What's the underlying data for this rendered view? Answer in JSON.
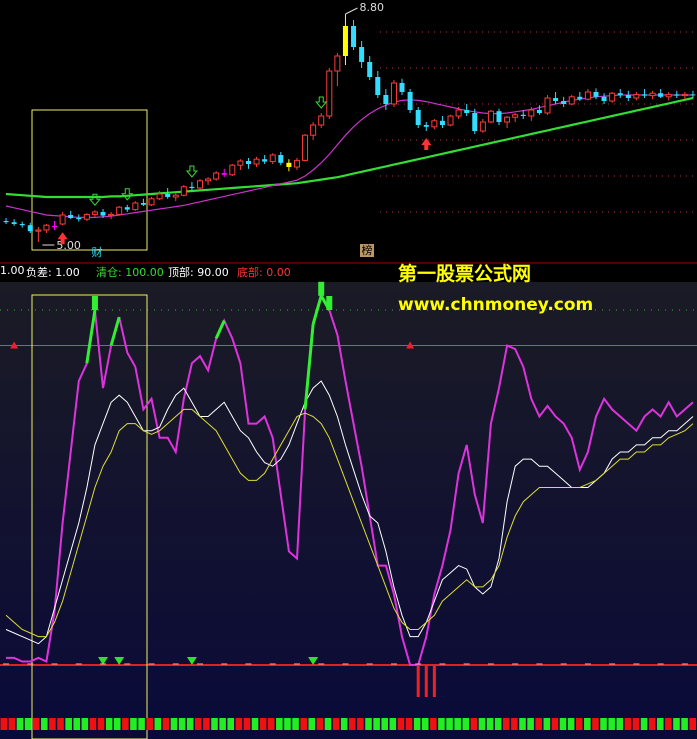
{
  "watermark": {
    "title": "第一股票公式网",
    "url": "www.chnmoney.com"
  },
  "indicator_bar": {
    "items": [
      {
        "text": "1.00",
        "color": "#ffffff"
      },
      {
        "text": "负差: 1.00",
        "color": "#ffffff"
      },
      {
        "text": "清仓: 100.00",
        "color": "#33dd33"
      },
      {
        "text": "顶部: 90.00",
        "color": "#ffffff"
      },
      {
        "text": "底部: 0.00",
        "color": "#ff3333"
      }
    ]
  },
  "colors": {
    "up": "#ff3b3b",
    "down": "#33ddff",
    "signal_magenta": "#ff00ff",
    "signal_yellow": "#ffff00",
    "ma_long": "#33dd33",
    "ma_short": "#cc33cc",
    "osc_fast": "#dd33dd",
    "osc_mid": "#ffffff",
    "osc_slow": "#dddd33"
  },
  "chart_data": [
    {
      "type": "candlestick",
      "title": "",
      "annotations": [
        {
          "text": "8.80",
          "kind": "high"
        },
        {
          "text": "5.00",
          "kind": "low"
        },
        {
          "text": "财",
          "kind": "marker"
        },
        {
          "text": "榜",
          "kind": "marker"
        }
      ],
      "x": [
        1,
        2,
        3,
        4,
        5,
        6,
        7,
        8,
        9,
        10,
        11,
        12,
        13,
        14,
        15,
        16,
        17,
        18,
        19,
        20,
        21,
        22,
        23,
        24,
        25,
        26,
        27,
        28,
        29,
        30,
        31,
        32,
        33,
        34,
        35,
        36,
        37,
        38,
        39,
        40,
        41,
        42,
        43,
        44,
        45,
        46,
        47,
        48,
        49,
        50,
        51,
        52,
        53,
        54,
        55,
        56,
        57,
        58,
        59,
        60,
        61,
        62,
        63,
        64,
        65,
        66,
        67,
        68,
        69,
        70,
        71,
        72,
        73,
        74,
        75,
        76,
        77,
        78,
        79,
        80,
        81,
        82,
        83,
        84,
        85,
        86
      ],
      "ohlc": [
        [
          5.35,
          5.4,
          5.3,
          5.33
        ],
        [
          5.33,
          5.38,
          5.27,
          5.3
        ],
        [
          5.3,
          5.34,
          5.24,
          5.28
        ],
        [
          5.28,
          5.32,
          5.15,
          5.18
        ],
        [
          5.18,
          5.25,
          5.0,
          5.2
        ],
        [
          5.2,
          5.3,
          5.15,
          5.28
        ],
        [
          5.27,
          5.35,
          5.2,
          5.25
        ],
        [
          5.3,
          5.5,
          5.28,
          5.45
        ],
        [
          5.45,
          5.52,
          5.38,
          5.4
        ],
        [
          5.4,
          5.46,
          5.34,
          5.38
        ],
        [
          5.38,
          5.48,
          5.35,
          5.46
        ],
        [
          5.46,
          5.53,
          5.42,
          5.5
        ],
        [
          5.5,
          5.55,
          5.4,
          5.44
        ],
        [
          5.44,
          5.5,
          5.38,
          5.46
        ],
        [
          5.46,
          5.6,
          5.44,
          5.58
        ],
        [
          5.58,
          5.62,
          5.5,
          5.54
        ],
        [
          5.54,
          5.68,
          5.52,
          5.65
        ],
        [
          5.65,
          5.72,
          5.6,
          5.62
        ],
        [
          5.62,
          5.75,
          5.6,
          5.72
        ],
        [
          5.72,
          5.85,
          5.7,
          5.8
        ],
        [
          5.8,
          5.9,
          5.72,
          5.75
        ],
        [
          5.75,
          5.82,
          5.68,
          5.78
        ],
        [
          5.78,
          5.95,
          5.76,
          5.92
        ],
        [
          5.92,
          6.0,
          5.85,
          5.9
        ],
        [
          5.9,
          6.05,
          5.88,
          6.02
        ],
        [
          6.02,
          6.08,
          5.95,
          6.05
        ],
        [
          6.05,
          6.18,
          6.02,
          6.15
        ],
        [
          6.15,
          6.22,
          6.08,
          6.12
        ],
        [
          6.12,
          6.3,
          6.1,
          6.28
        ],
        [
          6.28,
          6.38,
          6.2,
          6.35
        ],
        [
          6.35,
          6.4,
          6.22,
          6.3
        ],
        [
          6.3,
          6.42,
          6.25,
          6.38
        ],
        [
          6.38,
          6.45,
          6.3,
          6.34
        ],
        [
          6.34,
          6.48,
          6.3,
          6.45
        ],
        [
          6.45,
          6.5,
          6.28,
          6.32
        ],
        [
          6.32,
          6.38,
          6.18,
          6.25
        ],
        [
          6.25,
          6.4,
          6.2,
          6.36
        ],
        [
          6.36,
          6.8,
          6.34,
          6.78
        ],
        [
          6.78,
          7.0,
          6.7,
          6.95
        ],
        [
          6.95,
          7.15,
          6.9,
          7.1
        ],
        [
          7.1,
          7.9,
          7.05,
          7.85
        ],
        [
          7.85,
          8.15,
          7.6,
          8.1
        ],
        [
          8.1,
          8.8,
          7.95,
          8.6
        ],
        [
          8.6,
          8.7,
          8.2,
          8.25
        ],
        [
          8.25,
          8.35,
          7.9,
          8.0
        ],
        [
          8.0,
          8.1,
          7.7,
          7.75
        ],
        [
          7.75,
          7.85,
          7.4,
          7.45
        ],
        [
          7.45,
          7.55,
          7.2,
          7.3
        ],
        [
          7.3,
          7.7,
          7.25,
          7.65
        ],
        [
          7.65,
          7.72,
          7.45,
          7.5
        ],
        [
          7.5,
          7.55,
          7.15,
          7.2
        ],
        [
          7.2,
          7.25,
          6.9,
          6.95
        ],
        [
          6.95,
          7.0,
          6.85,
          6.92
        ],
        [
          6.92,
          7.05,
          6.88,
          7.02
        ],
        [
          7.02,
          7.1,
          6.9,
          6.95
        ],
        [
          6.95,
          7.12,
          6.93,
          7.1
        ],
        [
          7.1,
          7.25,
          7.05,
          7.2
        ],
        [
          7.2,
          7.3,
          7.1,
          7.15
        ],
        [
          7.15,
          7.22,
          6.8,
          6.85
        ],
        [
          6.85,
          7.05,
          6.82,
          7.0
        ],
        [
          7.0,
          7.2,
          6.98,
          7.18
        ],
        [
          7.18,
          7.22,
          6.95,
          7.0
        ],
        [
          7.0,
          7.1,
          6.9,
          7.08
        ],
        [
          7.08,
          7.15,
          7.0,
          7.12
        ],
        [
          7.12,
          7.2,
          7.05,
          7.1
        ],
        [
          7.1,
          7.25,
          7.02,
          7.2
        ],
        [
          7.2,
          7.28,
          7.12,
          7.15
        ],
        [
          7.15,
          7.45,
          7.12,
          7.4
        ],
        [
          7.4,
          7.5,
          7.3,
          7.35
        ],
        [
          7.35,
          7.42,
          7.25,
          7.3
        ],
        [
          7.3,
          7.45,
          7.28,
          7.42
        ],
        [
          7.42,
          7.5,
          7.35,
          7.38
        ],
        [
          7.38,
          7.55,
          7.36,
          7.5
        ],
        [
          7.5,
          7.56,
          7.38,
          7.42
        ],
        [
          7.42,
          7.48,
          7.3,
          7.35
        ],
        [
          7.35,
          7.5,
          7.32,
          7.48
        ],
        [
          7.48,
          7.55,
          7.4,
          7.45
        ],
        [
          7.45,
          7.52,
          7.35,
          7.4
        ],
        [
          7.4,
          7.5,
          7.36,
          7.46
        ],
        [
          7.46,
          7.55,
          7.4,
          7.44
        ],
        [
          7.44,
          7.52,
          7.38,
          7.48
        ],
        [
          7.48,
          7.55,
          7.4,
          7.42
        ],
        [
          7.42,
          7.5,
          7.36,
          7.46
        ],
        [
          7.46,
          7.52,
          7.4,
          7.44
        ],
        [
          7.44,
          7.5,
          7.38,
          7.46
        ],
        [
          7.46,
          7.52,
          7.4,
          7.45
        ]
      ],
      "special_bars": [
        {
          "index": 6,
          "style": "magenta"
        },
        {
          "index": 27,
          "style": "magenta"
        },
        {
          "index": 35,
          "style": "yellow"
        },
        {
          "index": 42,
          "style": "yellow"
        }
      ],
      "ma_long": [
        5.8,
        5.79,
        5.78,
        5.77,
        5.76,
        5.75,
        5.75,
        5.75,
        5.75,
        5.75,
        5.75,
        5.75,
        5.75,
        5.76,
        5.76,
        5.77,
        5.78,
        5.79,
        5.8,
        5.81,
        5.82,
        5.83,
        5.84,
        5.85,
        5.86,
        5.87,
        5.88,
        5.89,
        5.9,
        5.91,
        5.92,
        5.93,
        5.94,
        5.95,
        5.96,
        5.97,
        5.98,
        6.0,
        6.02,
        6.04,
        6.06,
        6.08,
        6.11,
        6.14,
        6.17,
        6.2,
        6.23,
        6.26,
        6.29,
        6.32,
        6.35,
        6.38,
        6.41,
        6.44,
        6.47,
        6.5,
        6.53,
        6.56,
        6.59,
        6.62,
        6.65,
        6.68,
        6.71,
        6.74,
        6.77,
        6.8,
        6.83,
        6.86,
        6.89,
        6.92,
        6.95,
        6.98,
        7.01,
        7.04,
        7.07,
        7.1,
        7.13,
        7.16,
        7.19,
        7.22,
        7.25,
        7.28,
        7.31,
        7.34,
        7.37,
        7.4
      ],
      "ma_short": [
        5.6,
        5.57,
        5.54,
        5.51,
        5.48,
        5.45,
        5.44,
        5.43,
        5.42,
        5.41,
        5.41,
        5.41,
        5.42,
        5.43,
        5.45,
        5.47,
        5.49,
        5.51,
        5.53,
        5.55,
        5.57,
        5.59,
        5.61,
        5.64,
        5.67,
        5.7,
        5.73,
        5.76,
        5.79,
        5.82,
        5.85,
        5.88,
        5.91,
        5.94,
        5.97,
        6.0,
        6.03,
        6.1,
        6.2,
        6.32,
        6.46,
        6.62,
        6.78,
        6.92,
        7.04,
        7.14,
        7.22,
        7.28,
        7.33,
        7.36,
        7.37,
        7.36,
        7.34,
        7.31,
        7.28,
        7.25,
        7.22,
        7.19,
        7.17,
        7.15,
        7.14,
        7.14,
        7.15,
        7.17,
        7.19,
        7.21,
        7.24,
        7.27,
        7.3,
        7.33,
        7.36,
        7.38,
        7.4,
        7.42,
        7.43,
        7.44,
        7.45,
        7.45,
        7.45,
        7.45,
        7.45,
        7.45,
        7.45,
        7.45,
        7.45,
        7.45
      ]
    },
    {
      "type": "line",
      "title": "",
      "ylim": [
        -5,
        105
      ],
      "levels": {
        "top": 90,
        "bottom": 0,
        "clear": 100
      },
      "x": [
        1,
        2,
        3,
        4,
        5,
        6,
        7,
        8,
        9,
        10,
        11,
        12,
        13,
        14,
        15,
        16,
        17,
        18,
        19,
        20,
        21,
        22,
        23,
        24,
        25,
        26,
        27,
        28,
        29,
        30,
        31,
        32,
        33,
        34,
        35,
        36,
        37,
        38,
        39,
        40,
        41,
        42,
        43,
        44,
        45,
        46,
        47,
        48,
        49,
        50,
        51,
        52,
        53,
        54,
        55,
        56,
        57,
        58,
        59,
        60,
        61,
        62,
        63,
        64,
        65,
        66,
        67,
        68,
        69,
        70,
        71,
        72,
        73,
        74,
        75,
        76,
        77,
        78,
        79,
        80,
        81,
        82,
        83,
        84,
        85,
        86
      ],
      "series": [
        {
          "values": [
            2,
            2,
            1,
            1,
            2,
            1,
            15,
            40,
            60,
            80,
            85,
            100,
            78,
            90,
            98,
            88,
            84,
            72,
            75,
            64,
            64,
            60,
            75,
            85,
            87,
            83,
            92,
            97,
            92,
            85,
            68,
            68,
            70,
            64,
            48,
            32,
            30,
            72,
            96,
            104,
            100,
            93,
            80,
            68,
            56,
            42,
            28,
            28,
            20,
            8,
            0,
            0,
            8,
            20,
            28,
            38,
            54,
            62,
            48,
            40,
            68,
            78,
            90,
            89,
            84,
            75,
            70,
            73,
            70,
            68,
            64,
            55,
            60,
            70,
            75,
            72,
            70,
            68,
            66,
            70,
            72,
            70,
            74,
            70,
            72,
            74
          ]
        },
        {
          "values": [
            10,
            9,
            8,
            7,
            6,
            8,
            16,
            24,
            32,
            40,
            50,
            62,
            68,
            74,
            76,
            74,
            70,
            66,
            66,
            67,
            72,
            76,
            78,
            74,
            70,
            70,
            72,
            74,
            70,
            66,
            64,
            60,
            57,
            56,
            58,
            62,
            68,
            74,
            78,
            80,
            76,
            70,
            62,
            55,
            48,
            42,
            40,
            32,
            22,
            14,
            8,
            8,
            12,
            18,
            24,
            26,
            28,
            27,
            22,
            20,
            22,
            30,
            46,
            56,
            58,
            58,
            56,
            56,
            54,
            52,
            50,
            50,
            50,
            52,
            54,
            58,
            60,
            60,
            62,
            62,
            64,
            64,
            66,
            66,
            68,
            70
          ]
        },
        {
          "values": [
            14,
            12,
            10,
            9,
            8,
            8,
            12,
            18,
            26,
            34,
            42,
            50,
            56,
            60,
            66,
            68,
            68,
            66,
            65,
            66,
            68,
            70,
            72,
            72,
            70,
            68,
            66,
            62,
            58,
            54,
            52,
            52,
            54,
            58,
            62,
            66,
            70,
            71,
            70,
            68,
            64,
            58,
            52,
            46,
            40,
            34,
            28,
            22,
            16,
            12,
            10,
            10,
            12,
            14,
            18,
            20,
            22,
            24,
            22,
            22,
            24,
            28,
            36,
            42,
            46,
            48,
            50,
            50,
            50,
            50,
            50,
            50,
            51,
            52,
            54,
            56,
            58,
            58,
            60,
            60,
            62,
            62,
            64,
            65,
            66,
            68
          ]
        }
      ],
      "signals": {
        "down_markers": [
          12,
          14,
          23,
          38
        ],
        "bottom_bars": [
          51,
          52,
          53
        ],
        "top_markers": [
          1,
          50
        ]
      },
      "bottom_strip": [
        "r",
        "r",
        "g",
        "g",
        "r",
        "g",
        "r",
        "r",
        "g",
        "g",
        "g",
        "r",
        "r",
        "g",
        "g",
        "r",
        "g",
        "g",
        "r",
        "g",
        "r",
        "g",
        "g",
        "g",
        "r",
        "r",
        "g",
        "g",
        "g",
        "r",
        "r",
        "g",
        "r",
        "r",
        "g",
        "g",
        "g",
        "r",
        "g",
        "r",
        "g",
        "r",
        "g",
        "r",
        "r",
        "g",
        "g",
        "g",
        "g",
        "r",
        "r",
        "g",
        "g",
        "r",
        "g",
        "g",
        "g",
        "g",
        "r",
        "g",
        "g",
        "g",
        "r",
        "r",
        "g",
        "g",
        "r",
        "g",
        "r",
        "g",
        "g",
        "r",
        "g",
        "r",
        "g",
        "g",
        "g",
        "r",
        "r",
        "g",
        "r",
        "g",
        "r",
        "g",
        "g",
        "r"
      ]
    }
  ]
}
